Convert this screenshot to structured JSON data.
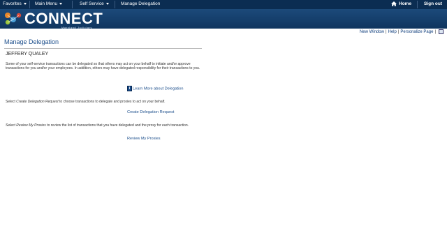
{
  "topnav": {
    "favorites": "Favorites",
    "main_menu": "Main Menu",
    "self_service": "Self Service",
    "breadcrumb_current": "Manage Delegation",
    "home": "Home",
    "sign_out": "Sign out"
  },
  "banner": {
    "logo_text": "CONNECT",
    "logo_subtitle": "Maryland Judiciary"
  },
  "utility_links": {
    "new_window": "New Window",
    "help": "Help",
    "personalize_page": "Personalize Page"
  },
  "main": {
    "title": "Manage Delegation",
    "employee_name": "JEFFERY QUALEY",
    "description": "Some of your self-service transactions can be delegated so that others may act on your behalf to initiate and/or approve transactions for you and/or your employees. In addition, others may have delegated responsibility for their transactions to you.",
    "learn_more_link": "Learn More about Delegation",
    "instruction1_prefix": "Select ",
    "instruction1_em": "Create Delegation Request",
    "instruction1_suffix": " to choose transactions to delegate and proxies to act on your behalf.",
    "create_link": "Create Delegation Request",
    "instruction2_prefix": "Select ",
    "instruction2_em": "Review My Proxies",
    "instruction2_suffix": " to review the list of transactions that you have delegated and the proxy for each transaction.",
    "review_link": "Review My Proxies"
  },
  "colors": {
    "nav_bg": "#0b2d52",
    "banner_bg": "#1c4a7a",
    "link": "#1d4f8c"
  }
}
